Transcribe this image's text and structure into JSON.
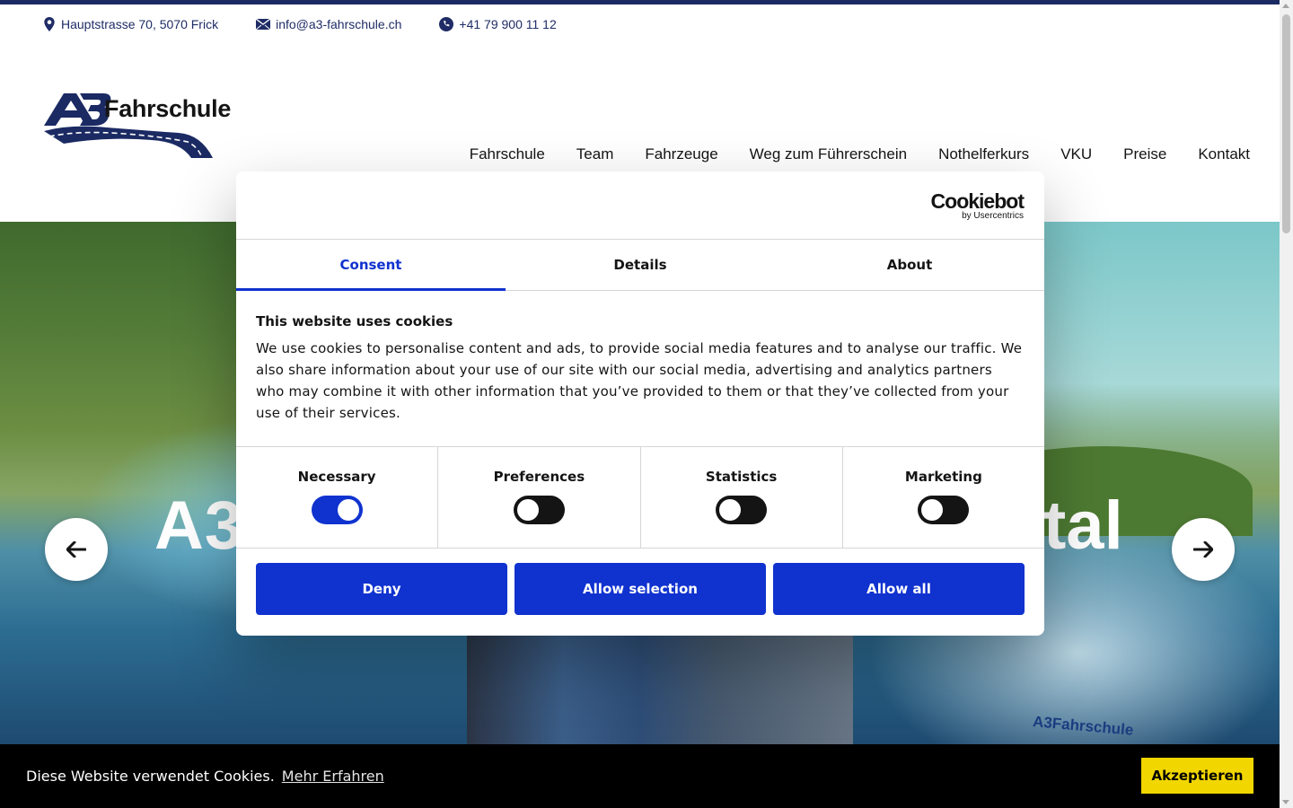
{
  "topbar": {
    "address": "Hauptstrasse 70, 5070 Frick",
    "email": "info@a3-fahrschule.ch",
    "phone": "+41 79 900 11 12"
  },
  "logo": {
    "text": "Fahrschule"
  },
  "nav": {
    "items": [
      "Fahrschule",
      "Team",
      "Fahrzeuge",
      "Weg zum Führerschein",
      "Nothelferkurs",
      "VKU",
      "Preise",
      "Kontakt"
    ]
  },
  "hero": {
    "title_left": "A3",
    "title_right": "tal",
    "car_logo": "A3Fahrschule"
  },
  "cookie_dialog": {
    "brand": "Cookiebot",
    "brand_sub": "by Usercentrics",
    "tabs": [
      "Consent",
      "Details",
      "About"
    ],
    "active_tab": "Consent",
    "title": "This website uses cookies",
    "text": "We use cookies to personalise content and ads, to provide social media features and to analyse our traffic. We also share information about your use of our site with our social media, advertising and analytics partners who may combine it with other information that you’ve provided to them or that they’ve collected from your use of their services.",
    "toggles": [
      {
        "label": "Necessary",
        "on": true
      },
      {
        "label": "Preferences",
        "on": false
      },
      {
        "label": "Statistics",
        "on": false
      },
      {
        "label": "Marketing",
        "on": false
      }
    ],
    "buttons": {
      "deny": "Deny",
      "allow_selection": "Allow selection",
      "allow_all": "Allow all"
    },
    "accent_color": "#1032cf"
  },
  "cookie_bar": {
    "message": "Diese Website verwendet Cookies.",
    "link": "Mehr Erfahren",
    "accept": "Akzeptieren",
    "accept_color": "#f1d600"
  },
  "colors": {
    "brand_navy": "#1b2a63"
  }
}
